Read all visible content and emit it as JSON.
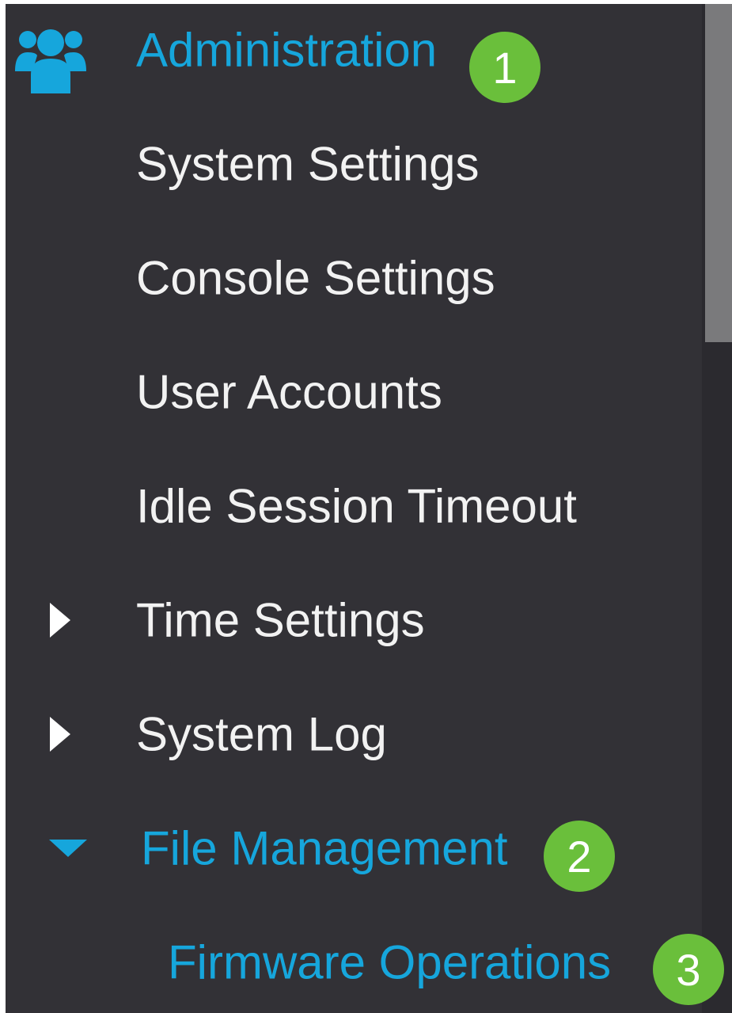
{
  "menu": {
    "header": {
      "label": "Administration",
      "icon": "users-icon",
      "step": "1"
    },
    "items": [
      {
        "label": "System Settings"
      },
      {
        "label": "Console Settings"
      },
      {
        "label": "User Accounts"
      },
      {
        "label": "Idle Session Timeout"
      },
      {
        "label": "Time Settings",
        "icon": "caret-right-icon"
      },
      {
        "label": "System Log",
        "icon": "caret-right-icon"
      },
      {
        "label": "File Management",
        "icon": "caret-down-icon",
        "step": "2"
      },
      {
        "label": "Firmware Operations",
        "step": "3"
      }
    ]
  },
  "colors": {
    "background": "#323136",
    "active_text": "#16a6dc",
    "text": "#f2f2f2",
    "badge": "#6abf3b"
  }
}
